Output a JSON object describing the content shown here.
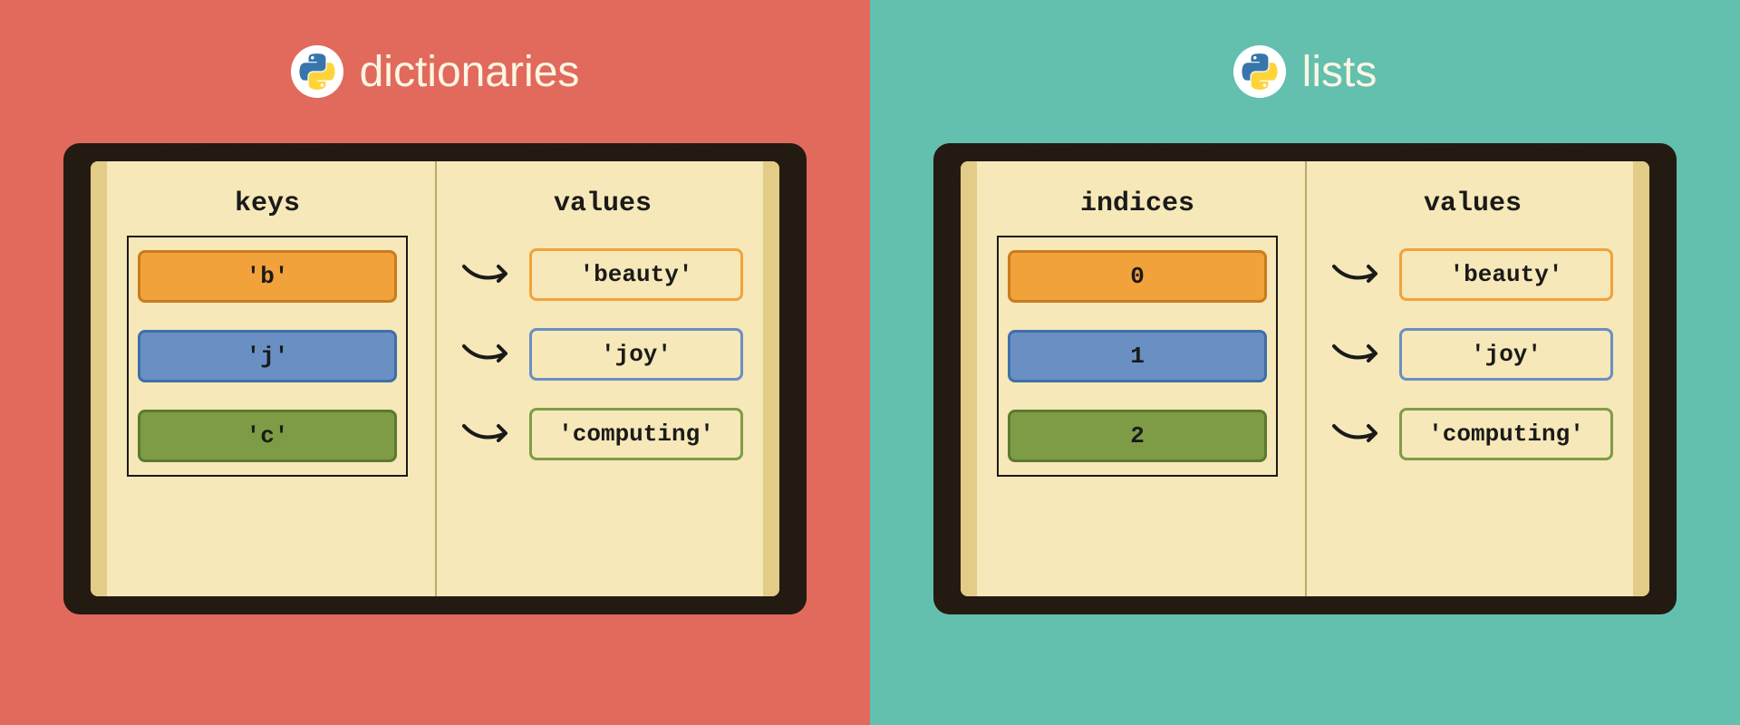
{
  "left": {
    "title": "dictionaries",
    "keys_label": "keys",
    "values_label": "values",
    "rows": [
      {
        "key": "'b'",
        "value": "'beauty'",
        "color": "orange"
      },
      {
        "key": "'j'",
        "value": "'joy'",
        "color": "blue"
      },
      {
        "key": "'c'",
        "value": "'computing'",
        "color": "green"
      }
    ]
  },
  "right": {
    "title": "lists",
    "keys_label": "indices",
    "values_label": "values",
    "rows": [
      {
        "key": "0",
        "value": "'beauty'",
        "color": "orange"
      },
      {
        "key": "1",
        "value": "'joy'",
        "color": "blue"
      },
      {
        "key": "2",
        "value": "'computing'",
        "color": "green"
      }
    ]
  },
  "colors": {
    "panel_left": "#E16A5D",
    "panel_right": "#63BFAE",
    "book_cover": "#231A12",
    "book_page": "#F6E8B8",
    "orange": "#F2A23A",
    "blue": "#6A8FC2",
    "green": "#7E9C46"
  }
}
